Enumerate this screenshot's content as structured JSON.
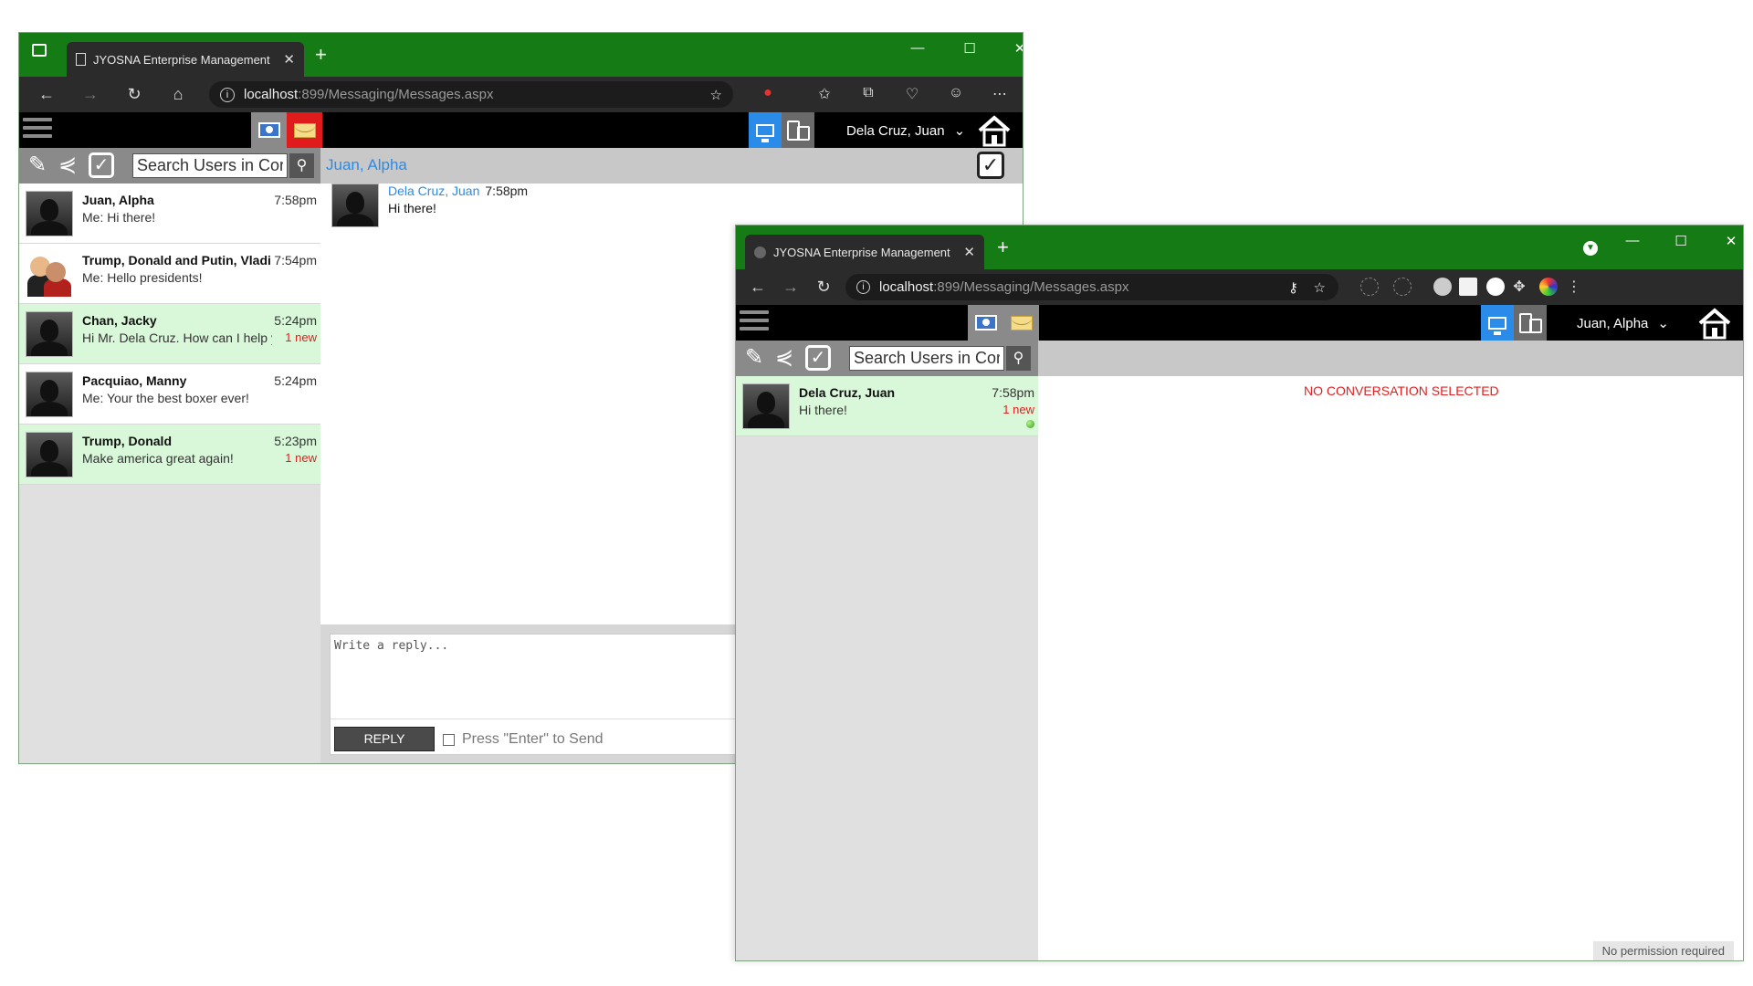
{
  "windowA": {
    "tab_title": "JYOSNA Enterprise Management",
    "url_host": "localhost",
    "url_path": ":899/Messaging/Messages.aspx",
    "current_user": "Dela Cruz, Juan",
    "search_placeholder": "Search Users in Cor",
    "active_chat_name": "Juan, Alpha",
    "conversations": [
      {
        "name": "Juan, Alpha",
        "preview": "Me: Hi there!",
        "time": "7:58pm",
        "badge": "",
        "unread": false
      },
      {
        "name": "Trump, Donald and Putin, Vladi",
        "preview": "Me: Hello presidents!",
        "time": "7:54pm",
        "badge": "",
        "unread": false
      },
      {
        "name": "Chan, Jacky",
        "preview": "Hi Mr. Dela Cruz. How can I help y",
        "time": "5:24pm",
        "badge": "1 new",
        "unread": true
      },
      {
        "name": "Pacquiao, Manny",
        "preview": "Me: Your the best boxer ever!",
        "time": "5:24pm",
        "badge": "",
        "unread": false
      },
      {
        "name": "Trump, Donald",
        "preview": "Make america great again!",
        "time": "5:23pm",
        "badge": "1 new",
        "unread": true
      }
    ],
    "message": {
      "sender": "Dela Cruz, Juan",
      "time": "7:58pm",
      "text": "Hi there!"
    },
    "reply_placeholder": "Write a reply...",
    "reply_button": "REPLY",
    "enter_to_send": "Press \"Enter\" to Send"
  },
  "windowB": {
    "tab_title": "JYOSNA Enterprise Management",
    "url_host": "localhost",
    "url_path": ":899/Messaging/Messages.aspx",
    "current_user": "Juan, Alpha",
    "search_placeholder": "Search Users in Cor",
    "conversations": [
      {
        "name": "Dela Cruz, Juan",
        "preview": "Hi there!",
        "time": "7:58pm",
        "badge": "1 new",
        "unread": true,
        "online": true
      }
    ],
    "empty_state": "NO CONVERSATION SELECTED",
    "footer_status": "No permission required"
  },
  "colors": {
    "titlebar": "#157b15",
    "accent_blue": "#2a8be8",
    "unread_bg": "#d9f7d9",
    "new_badge": "#e02020",
    "mail_active": "#e01b1b"
  }
}
